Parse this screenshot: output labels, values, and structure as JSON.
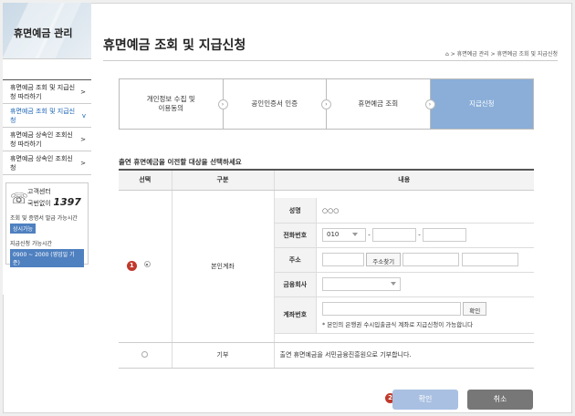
{
  "sidebar": {
    "title": "휴면예금 관리",
    "items": [
      {
        "label": "휴면예금 조회 및 지급신청 따라하기",
        "chev": ">"
      },
      {
        "label": "휴면예금 조회 및 지급신청",
        "chev": "v"
      },
      {
        "label": "휴면예금 상속인 조회신청 따라하기",
        "chev": ">"
      },
      {
        "label": "휴면예금 상속인 조회신청",
        "chev": ">"
      }
    ],
    "customer_center": {
      "label1": "고객센터",
      "label2": "국번없이",
      "number": "1397",
      "hours_title": "조회 및 증명서 발급 가능시간",
      "hours_badge": "상시가능",
      "pay_title": "지급신청 가능시간",
      "pay_badge": "0900 ~ 2000 (영업일 기준)"
    }
  },
  "page": {
    "title": "휴면예금 조회 및 지급신청",
    "breadcrumb": [
      "휴면예금 관리",
      "휴면예금 조회 및 지급신청"
    ]
  },
  "steps": [
    {
      "label": "개인정보 수집 및 이용동의",
      "active": false
    },
    {
      "label": "공인인증서 인증",
      "active": false
    },
    {
      "label": "휴면예금 조회",
      "active": false
    },
    {
      "label": "지급신청",
      "active": true
    }
  ],
  "section_title": "출연 휴면예금을 이전할 대상을 선택하세요",
  "table": {
    "headers": [
      "선택",
      "구분",
      "내용"
    ],
    "row1": {
      "badge": "1",
      "type": "본인계좌",
      "name_label": "성명",
      "name_value": "○○○",
      "phone_label": "전화번호",
      "phone_prefix": "010",
      "phone_sep": "-",
      "address_label": "주소",
      "address_btn": "주소찾기",
      "bank_label": "금융회사",
      "account_label": "계좌번호",
      "account_btn": "확인",
      "account_note": "* 본인의 은행권 수시입출금식 계좌로 지급신청이 가능합니다"
    },
    "row2": {
      "type": "기부",
      "content": "출연 휴면예금을 서민금융진흥원으로 기부합니다."
    }
  },
  "buttons": {
    "badge": "2",
    "confirm": "확인",
    "cancel": "취소"
  }
}
